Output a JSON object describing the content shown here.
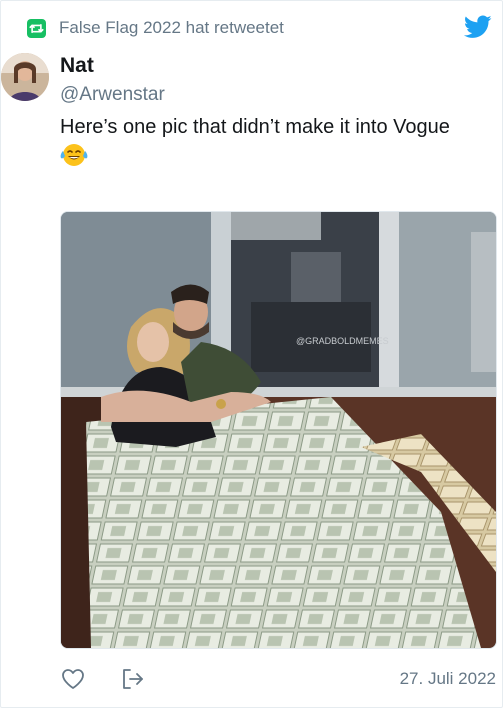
{
  "retweet": {
    "label": "False Flag 2022 hat retweetet"
  },
  "tweet": {
    "author_name": "Nat",
    "handle": "@Arwenstar",
    "text": "Here’s one pic that didn’t make it into Vogue",
    "emoji": "face-with-tears-of-joy",
    "date": "27. Juli 2022"
  },
  "media": {
    "watermark": "@GRADBOLDMEMES"
  },
  "colors": {
    "accent": "#1da1f2",
    "retweet": "#17bf63",
    "muted": "#657786"
  },
  "icons": {
    "retweet": "retweet-icon",
    "logo": "twitter-bird-icon",
    "like": "heart-icon",
    "share": "share-icon"
  }
}
